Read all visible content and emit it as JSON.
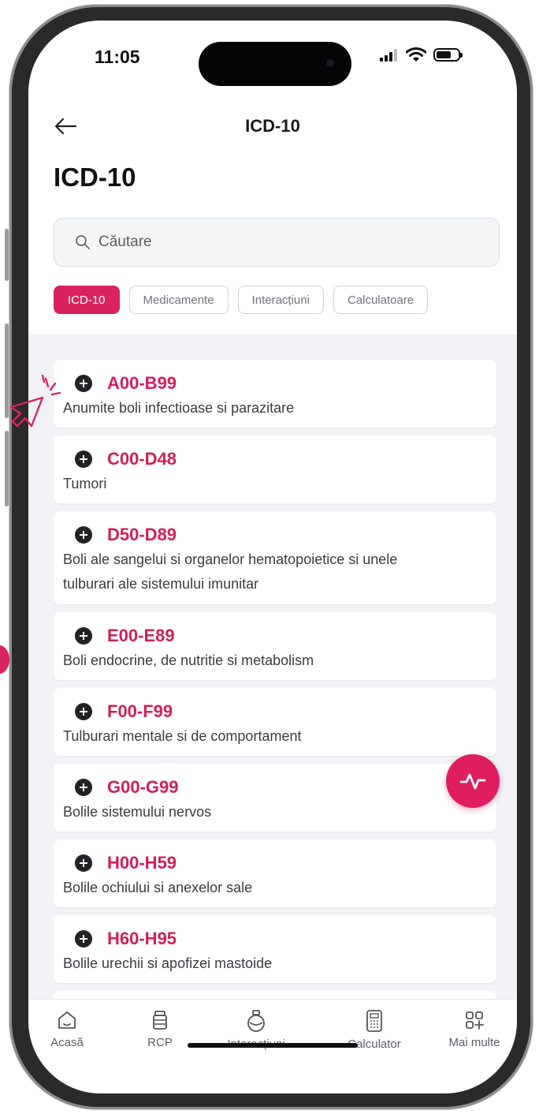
{
  "status_bar": {
    "time": "11:05",
    "icons": [
      "signal-icon",
      "wifi-icon",
      "battery-icon"
    ]
  },
  "nav": {
    "back_icon": "arrow-left-icon",
    "title": "ICD-10"
  },
  "page_title": "ICD-10",
  "search": {
    "icon": "search-icon",
    "placeholder": "Căutare"
  },
  "chips": [
    {
      "label": "ICD-10",
      "active": true
    },
    {
      "label": "Medicamente",
      "active": false
    },
    {
      "label": "Interacțiuni",
      "active": false
    },
    {
      "label": "Calculatoare",
      "active": false
    }
  ],
  "categories": [
    {
      "code": "A00-B99",
      "description": "Anumite boli infectioase si parazitare"
    },
    {
      "code": "C00-D48",
      "description": "Tumori"
    },
    {
      "code": "D50-D89",
      "description": "Boli ale sangelui si organelor hematopoietice si unele",
      "description_line2": "tulburari ale sistemului imunitar"
    },
    {
      "code": "E00-E89",
      "description": "Boli endocrine, de nutritie si metabolism"
    },
    {
      "code": "F00-F99",
      "description": "Tulburari mentale si de comportament"
    },
    {
      "code": "G00-G99",
      "description": "Bolile sistemului nervos"
    },
    {
      "code": "H00-H59",
      "description": "Bolile ochiului si anexelor sale"
    },
    {
      "code": "H60-H95",
      "description": "Bolile urechii si apofizei mastoide"
    }
  ],
  "fab": {
    "icon": "pulse-icon"
  },
  "bottom_nav": [
    {
      "label": "Acasă",
      "icon": "home-icon"
    },
    {
      "label": "RCP",
      "icon": "pill-bottle-icon"
    },
    {
      "label": "Interacțiuni",
      "icon": "flask-icon"
    },
    {
      "label": "Calculator",
      "icon": "calculator-icon"
    },
    {
      "label": "Mai multe",
      "icon": "grid-plus-icon"
    }
  ],
  "colors": {
    "accent": "#d8235e",
    "code_text": "#d21e58",
    "background": "#f2f2f6"
  }
}
